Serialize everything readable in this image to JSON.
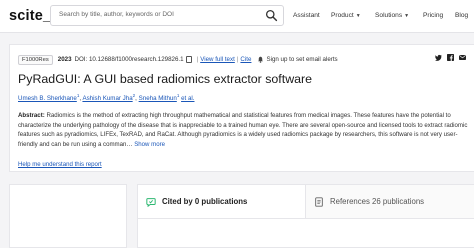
{
  "header": {
    "logo": "scite_",
    "search_placeholder": "Search by title, author, keywords or DOI",
    "nav": {
      "assistant": "Assistant",
      "product": "Product",
      "solutions": "Solutions",
      "pricing": "Pricing",
      "blog": "Blog"
    }
  },
  "paper": {
    "journal": "F1000Res",
    "year": "2023",
    "doi": "DOI: 10.12688/f1000research.129826.1",
    "view_full_text": "View full text",
    "cite": "Cite",
    "alerts": "Sign up to set email alerts",
    "title": "PyRadGUI: A GUI based radiomics extractor software",
    "authors": [
      {
        "name": "Umesh B. Sherkhane",
        "sup": "1"
      },
      {
        "name": "Ashish Kumar Jha",
        "sup": "2"
      },
      {
        "name": "Sneha Mithun",
        "sup": "1"
      }
    ],
    "et_al": "et al.",
    "abstract_label": "Abstract:",
    "abstract_text": " Radiomics is the method of extracting high throughput mathematical and statistical features from medical images. These features have the potential to characterize the underlying pathology of the disease that is inappreciable to a trained human eye. There are several open-source and licensed tools to extract radiomic features such as pyradiomics, LIFEx, TexRAD, and RaCat. Although pyradiomics is a widely used radiomics package by researchers, this software is not very user-friendly and can be run using a comman…",
    "show_more": "Show more",
    "help_link": "Help me understand this report"
  },
  "tabs": {
    "cited_by": "Cited by 0 publications",
    "references": "References 26 publications"
  },
  "colors": {
    "link": "#1a56b8",
    "cited_icon": "#2eb872"
  },
  "icons": [
    "search-icon",
    "copy-icon",
    "bell-icon",
    "twitter-icon",
    "facebook-icon",
    "mail-icon",
    "chevron-down-icon",
    "chat-icon",
    "document-icon"
  ]
}
